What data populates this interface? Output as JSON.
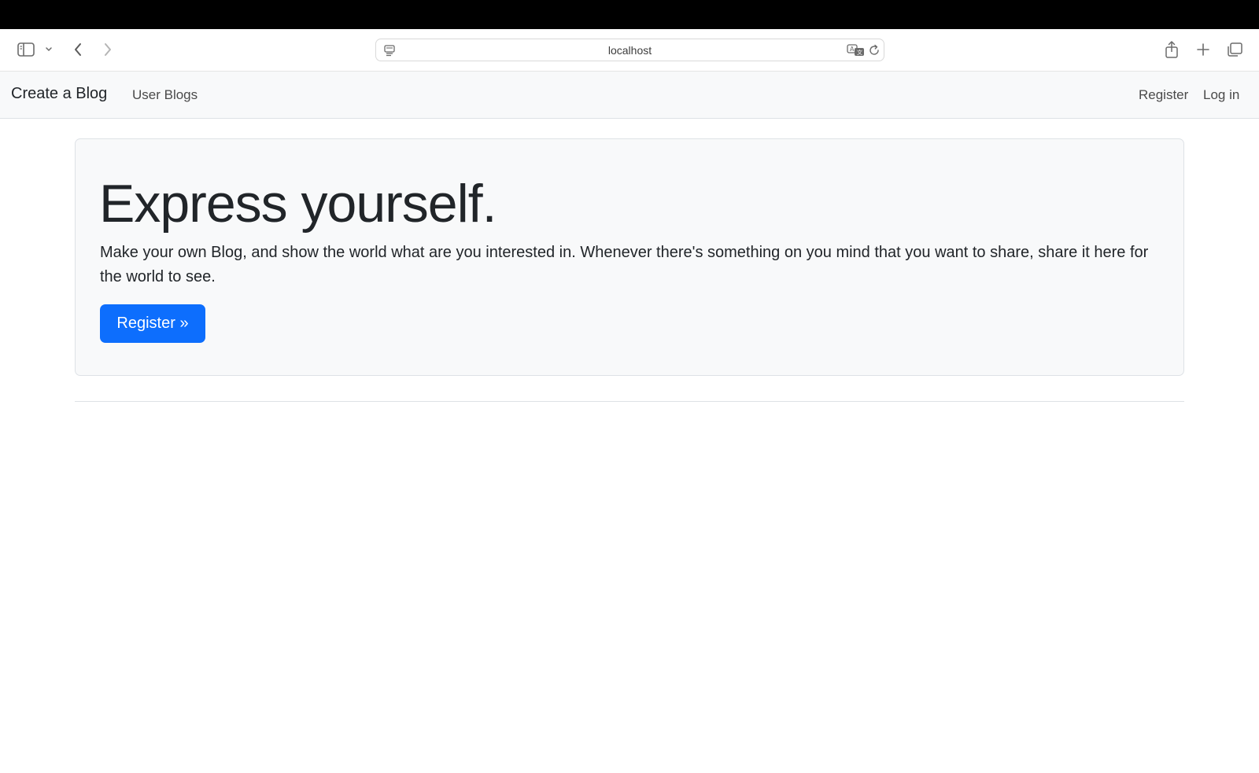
{
  "browser": {
    "url": "localhost",
    "icons": {
      "sidebar": "sidebar-icon",
      "sidebar_menu": "chevron-down-icon",
      "back": "chevron-left-icon",
      "forward": "chevron-right-icon",
      "page": "page-menu-icon",
      "translate": "translate-icon",
      "reload": "reload-icon",
      "share": "share-icon",
      "new_tab": "plus-icon",
      "tab_overview": "tabs-icon"
    }
  },
  "navbar": {
    "brand": "Create a Blog",
    "links": [
      {
        "label": "User Blogs"
      }
    ],
    "right_links": [
      {
        "label": "Register"
      },
      {
        "label": "Log in"
      }
    ]
  },
  "hero": {
    "title": "Express yourself.",
    "text": "Make your own Blog, and show the world what are you interested in. Whenever there's something on you mind that you want to share, share it here for the world to see.",
    "button_label": "Register »"
  },
  "colors": {
    "primary": "#0d6efd",
    "navbar_bg": "#f8f9fa",
    "text": "#212529"
  }
}
